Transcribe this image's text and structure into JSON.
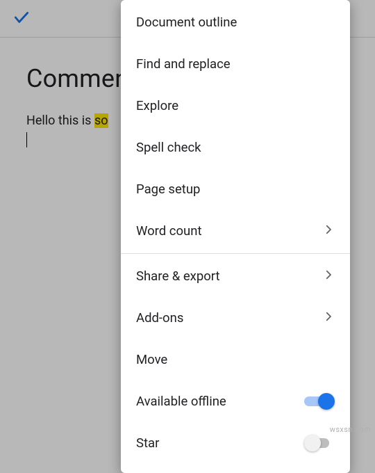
{
  "topbar": {
    "confirm_icon": "check"
  },
  "document": {
    "title": "Comment usage",
    "body_prefix": "Hello this is ",
    "body_highlight": "so"
  },
  "menu": {
    "items": [
      {
        "key": "document-outline",
        "label": "Document outline",
        "type": "plain"
      },
      {
        "key": "find-replace",
        "label": "Find and replace",
        "type": "plain"
      },
      {
        "key": "explore",
        "label": "Explore",
        "type": "plain"
      },
      {
        "key": "spell-check",
        "label": "Spell check",
        "type": "plain"
      },
      {
        "key": "page-setup",
        "label": "Page setup",
        "type": "plain"
      },
      {
        "key": "word-count",
        "label": "Word count",
        "type": "chevron"
      },
      {
        "key": "divider-1",
        "type": "divider"
      },
      {
        "key": "share-export",
        "label": "Share & export",
        "type": "chevron"
      },
      {
        "key": "add-ons",
        "label": "Add-ons",
        "type": "chevron"
      },
      {
        "key": "move",
        "label": "Move",
        "type": "plain"
      },
      {
        "key": "available-offline",
        "label": "Available offline",
        "type": "toggle",
        "value": true
      },
      {
        "key": "star",
        "label": "Star",
        "type": "toggle",
        "value": false
      }
    ]
  },
  "colors": {
    "accent": "#1a73e8",
    "highlight": "#ffe600"
  },
  "watermark": "wsxsn.com"
}
